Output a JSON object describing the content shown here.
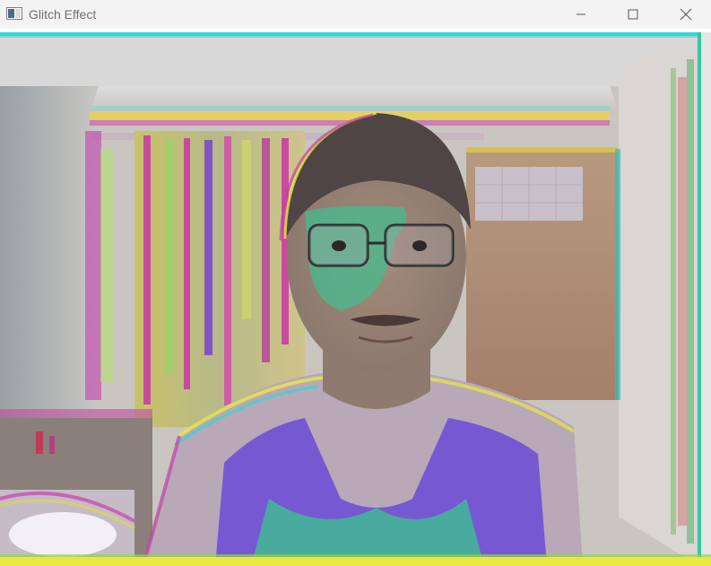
{
  "window": {
    "title": "Glitch Effect"
  },
  "titlebar": {
    "app_icon": "window-app-icon",
    "minimize_icon": "minimize-icon",
    "maximize_icon": "maximize-icon",
    "close_icon": "close-icon"
  },
  "colors": {
    "titlebar_bg": "#f3f3f3",
    "title_text": "#707070",
    "glitch_cyan": "#2ed9d9",
    "glitch_magenta": "#c040a8",
    "glitch_yellow": "#e8e840",
    "glitch_purple": "#6a4bd6",
    "glitch_green": "#3fbf90"
  }
}
